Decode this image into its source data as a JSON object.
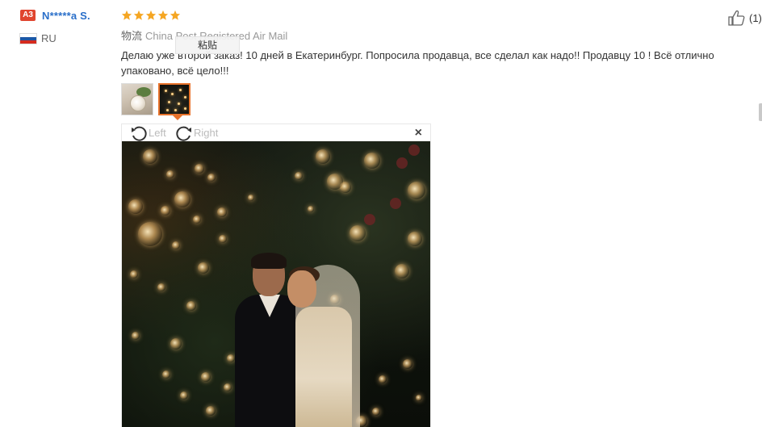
{
  "user": {
    "level_badge": "A3",
    "name": "N*****a S.",
    "country": "RU",
    "flag_colors": [
      "#ffffff",
      "#1c57a5",
      "#d52b1e"
    ]
  },
  "review": {
    "rating": 5,
    "star_color": "#f5a623",
    "logistics_label": "物流",
    "logistics_value": "China Post Registered Air Mail",
    "text": "Делаю уже второй заказ! 10 дней в Екатеринбург. Попросила продавца, все сделал как надо!! Продавцу 10 ! Всё отлично упаковано, всё цело!!!",
    "tooltip": "粘贴"
  },
  "helpful": {
    "icon": "thumbs-up-icon",
    "count": "(1)"
  },
  "thumbnails": [
    {
      "name": "review-photo-1",
      "active": false
    },
    {
      "name": "review-photo-2",
      "active": true
    }
  ],
  "viewer": {
    "rotate_left_label": "Left",
    "rotate_right_label": "Right",
    "close_label": "×"
  },
  "colors": {
    "accent": "#e8732c",
    "link": "#2a6fc9",
    "badge": "#e0452f"
  }
}
